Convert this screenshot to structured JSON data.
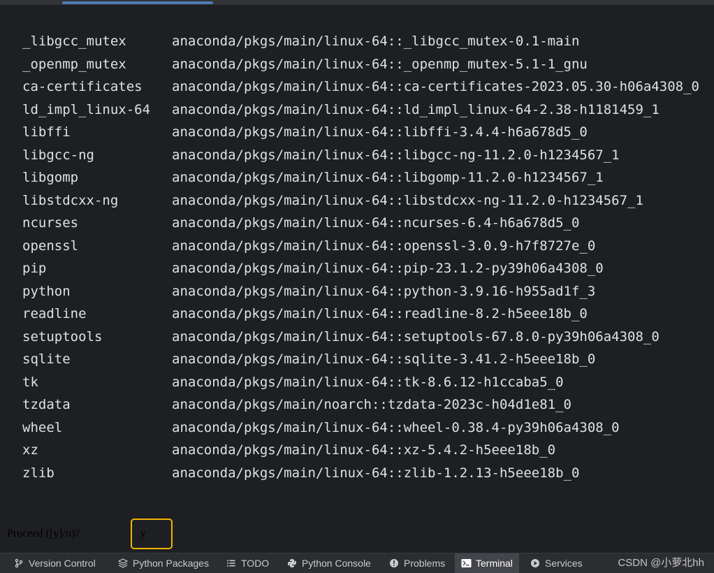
{
  "packages": [
    {
      "name": "_libgcc_mutex",
      "spec": "anaconda/pkgs/main/linux-64::_libgcc_mutex-0.1-main"
    },
    {
      "name": "_openmp_mutex",
      "spec": "anaconda/pkgs/main/linux-64::_openmp_mutex-5.1-1_gnu"
    },
    {
      "name": "ca-certificates",
      "spec": "anaconda/pkgs/main/linux-64::ca-certificates-2023.05.30-h06a4308_0"
    },
    {
      "name": "ld_impl_linux-64",
      "spec": "anaconda/pkgs/main/linux-64::ld_impl_linux-64-2.38-h1181459_1"
    },
    {
      "name": "libffi",
      "spec": "anaconda/pkgs/main/linux-64::libffi-3.4.4-h6a678d5_0"
    },
    {
      "name": "libgcc-ng",
      "spec": "anaconda/pkgs/main/linux-64::libgcc-ng-11.2.0-h1234567_1"
    },
    {
      "name": "libgomp",
      "spec": "anaconda/pkgs/main/linux-64::libgomp-11.2.0-h1234567_1"
    },
    {
      "name": "libstdcxx-ng",
      "spec": "anaconda/pkgs/main/linux-64::libstdcxx-ng-11.2.0-h1234567_1"
    },
    {
      "name": "ncurses",
      "spec": "anaconda/pkgs/main/linux-64::ncurses-6.4-h6a678d5_0"
    },
    {
      "name": "openssl",
      "spec": "anaconda/pkgs/main/linux-64::openssl-3.0.9-h7f8727e_0"
    },
    {
      "name": "pip",
      "spec": "anaconda/pkgs/main/linux-64::pip-23.1.2-py39h06a4308_0"
    },
    {
      "name": "python",
      "spec": "anaconda/pkgs/main/linux-64::python-3.9.16-h955ad1f_3"
    },
    {
      "name": "readline",
      "spec": "anaconda/pkgs/main/linux-64::readline-8.2-h5eee18b_0"
    },
    {
      "name": "setuptools",
      "spec": "anaconda/pkgs/main/linux-64::setuptools-67.8.0-py39h06a4308_0"
    },
    {
      "name": "sqlite",
      "spec": "anaconda/pkgs/main/linux-64::sqlite-3.41.2-h5eee18b_0"
    },
    {
      "name": "tk",
      "spec": "anaconda/pkgs/main/linux-64::tk-8.6.12-h1ccaba5_0"
    },
    {
      "name": "tzdata",
      "spec": "anaconda/pkgs/main/noarch::tzdata-2023c-h04d1e81_0"
    },
    {
      "name": "wheel",
      "spec": "anaconda/pkgs/main/linux-64::wheel-0.38.4-py39h06a4308_0"
    },
    {
      "name": "xz",
      "spec": "anaconda/pkgs/main/linux-64::xz-5.4.2-h5eee18b_0"
    },
    {
      "name": "zlib",
      "spec": "anaconda/pkgs/main/linux-64::zlib-1.2.13-h5eee18b_0"
    }
  ],
  "prompt": {
    "text": "Proceed ([y]/n)?",
    "answer": "y"
  },
  "tool_tabs": [
    {
      "label": "Version Control",
      "icon": "branch-icon",
      "active": false
    },
    {
      "label": "Python Packages",
      "icon": "layers-icon",
      "active": false
    },
    {
      "label": "TODO",
      "icon": "list-icon",
      "active": false
    },
    {
      "label": "Python Console",
      "icon": "python-icon",
      "active": false
    },
    {
      "label": "Problems",
      "icon": "info-icon",
      "active": false
    },
    {
      "label": "Terminal",
      "icon": "terminal-icon",
      "active": true
    },
    {
      "label": "Services",
      "icon": "play-icon",
      "active": false
    }
  ],
  "watermark": "CSDN @小萝北hh",
  "colors": {
    "highlight_box": "#f0b400",
    "terminal_bg": "#1e1f22",
    "text": "#dfe1e5"
  }
}
